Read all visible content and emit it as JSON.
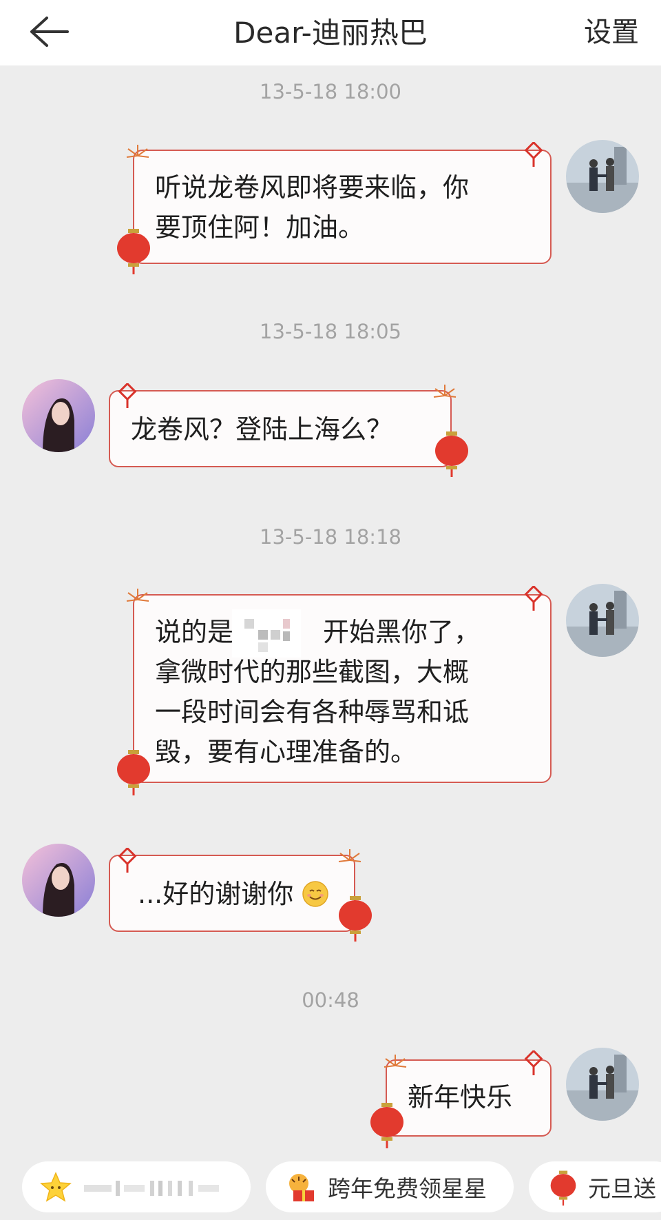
{
  "header": {
    "title": "Dear-迪丽热巴",
    "settings_label": "设置"
  },
  "messages": [
    {
      "time": "13-5-18 18:00",
      "side": "right",
      "lines": [
        "听说龙卷风即将要来临，你",
        "要顶住阿！加油。"
      ]
    },
    {
      "time": "13-5-18 18:05",
      "side": "left",
      "lines": [
        "龙卷风？登陆上海么？"
      ]
    },
    {
      "time": "13-5-18 18:18",
      "side": "right",
      "lines": [
        "说的是",
        "开始黑你了，",
        "拿微时代的那些截图，大概",
        "一段时间会有各种辱骂和诋",
        "毁，要有心理准备的。"
      ]
    },
    {
      "time": "",
      "side": "left",
      "lines": [
        "...好的谢谢你"
      ]
    },
    {
      "time": "00:48",
      "side": "right",
      "lines": [
        "新年快乐"
      ]
    }
  ],
  "shortcuts": [
    {
      "label": "",
      "icon": "star-icon"
    },
    {
      "label": "跨年免费领星星",
      "icon": "tiger-gift-icon"
    },
    {
      "label": "元旦送",
      "icon": "lantern-icon"
    }
  ],
  "colors": {
    "bubble_border": "#d55a52",
    "background": "#ededed",
    "timestamp": "#a3a3a3"
  }
}
